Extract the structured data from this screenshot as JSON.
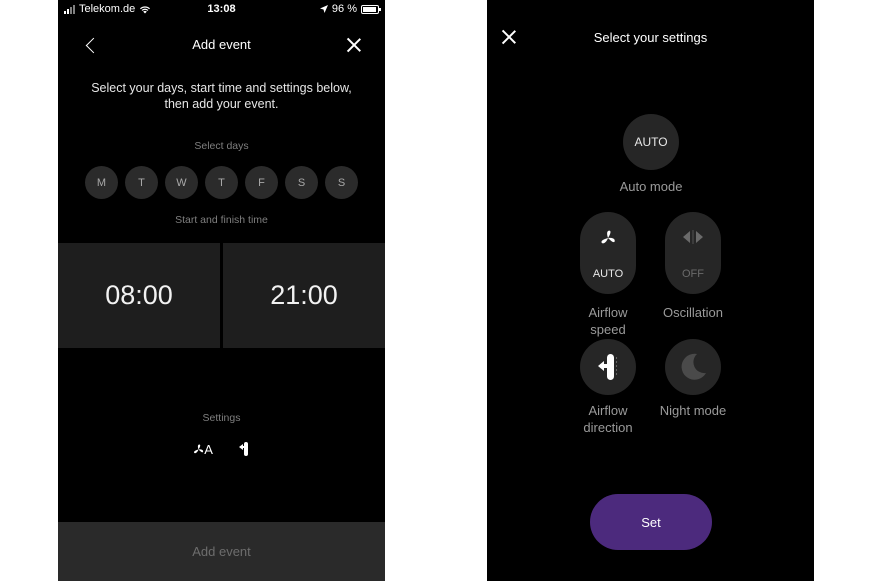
{
  "left": {
    "status": {
      "carrier": "Telekom.de",
      "time": "13:08",
      "battery": "96 %",
      "battery_level": 0.96
    },
    "title": "Add event",
    "intro": "Select your days, start time and settings below, then add your event.",
    "select_days_label": "Select days",
    "days": [
      "M",
      "T",
      "W",
      "T",
      "F",
      "S",
      "S"
    ],
    "time_label": "Start and finish time",
    "start_time": "08:00",
    "finish_time": "21:00",
    "settings_label": "Settings",
    "settings_fan_text": "A",
    "add_event": "Add event"
  },
  "right": {
    "title": "Select your settings",
    "auto_button": "AUTO",
    "auto_label": "Auto mode",
    "airflow_speed_value": "AUTO",
    "airflow_speed_label_1": "Airflow",
    "airflow_speed_label_2": "speed",
    "oscillation_value": "OFF",
    "oscillation_label": "Oscillation",
    "airflow_direction_label_1": "Airflow",
    "airflow_direction_label_2": "direction",
    "night_mode_label": "Night mode",
    "set_button": "Set"
  },
  "colors": {
    "background": "#000000",
    "panel": "#1e1e1e",
    "circle": "#2b2b2b",
    "accent": "#4c2a7d",
    "muted_text": "#9a9a9a"
  },
  "icons": [
    "back-chevron-icon",
    "close-icon",
    "fan-icon",
    "airflow-direction-icon",
    "oscillation-arrows-icon",
    "moon-icon",
    "wifi-icon",
    "location-arrow-icon",
    "battery-icon"
  ]
}
